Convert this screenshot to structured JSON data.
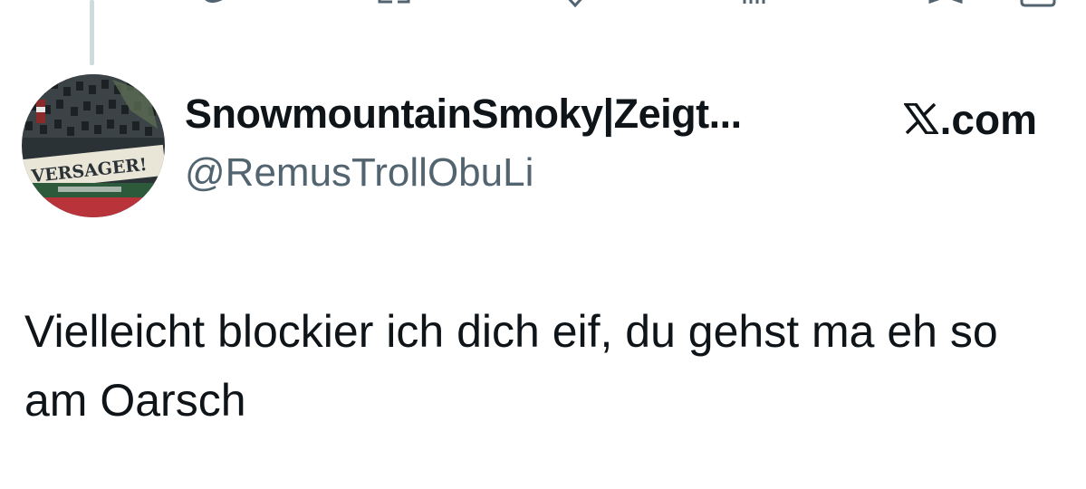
{
  "tweet": {
    "author": {
      "display_name": "SnowmountainSmoky|Zeigt...",
      "handle": "@RemusTrollObuLi",
      "avatar_banner_text": "VERSAGER!"
    },
    "source": {
      "brand_suffix": ".com",
      "logo_icon": "x-logo-icon"
    },
    "text": "Vielleicht blockier ich dich eif, du gehst ma eh so am Oarsch"
  },
  "action_bar": {
    "icons": [
      "reply-icon",
      "retweet-icon",
      "like-icon",
      "views-icon",
      "bookmark-icon",
      "share-icon"
    ]
  },
  "colors": {
    "text_primary": "#0f1419",
    "text_secondary": "#536471",
    "thread_line": "#cfd9de"
  }
}
